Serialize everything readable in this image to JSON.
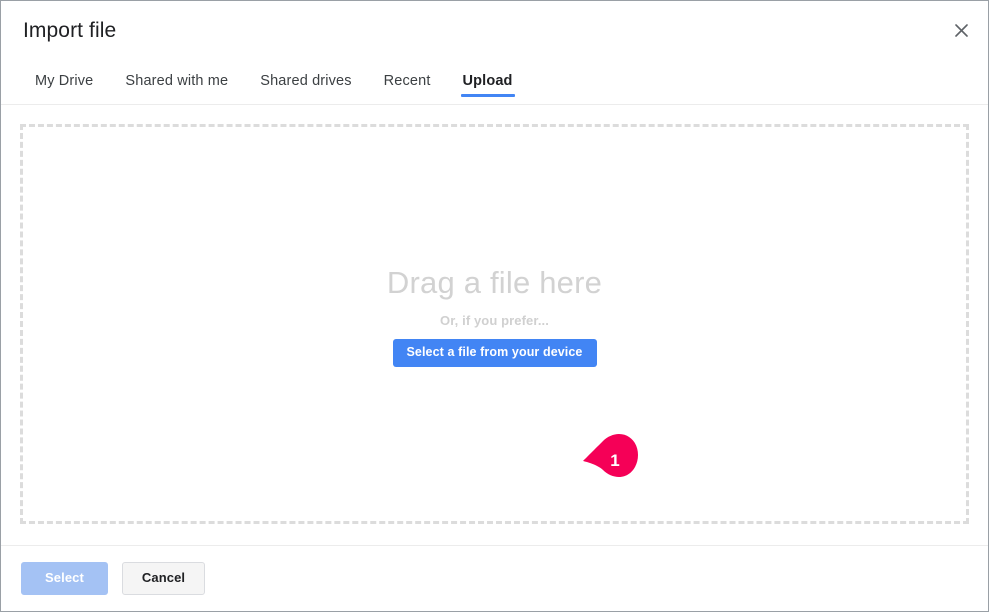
{
  "dialog": {
    "title": "Import file",
    "close_icon": "close-icon"
  },
  "tabs": [
    {
      "label": "My Drive",
      "active": false
    },
    {
      "label": "Shared with me",
      "active": false
    },
    {
      "label": "Shared drives",
      "active": false
    },
    {
      "label": "Recent",
      "active": false
    },
    {
      "label": "Upload",
      "active": true
    }
  ],
  "dropzone": {
    "drag_text": "Drag a file here",
    "or_text": "Or, if you prefer...",
    "select_file_label": "Select a file from your device"
  },
  "annotation": {
    "step_number": "1",
    "color": "#f50057"
  },
  "footer": {
    "select_label": "Select",
    "cancel_label": "Cancel"
  },
  "colors": {
    "accent_blue": "#4285f4",
    "disabled_blue": "#a4c2f4",
    "marker_pink": "#f50057",
    "placeholder_gray": "#d2d2d2",
    "dashed_border": "#dcdcdc"
  }
}
